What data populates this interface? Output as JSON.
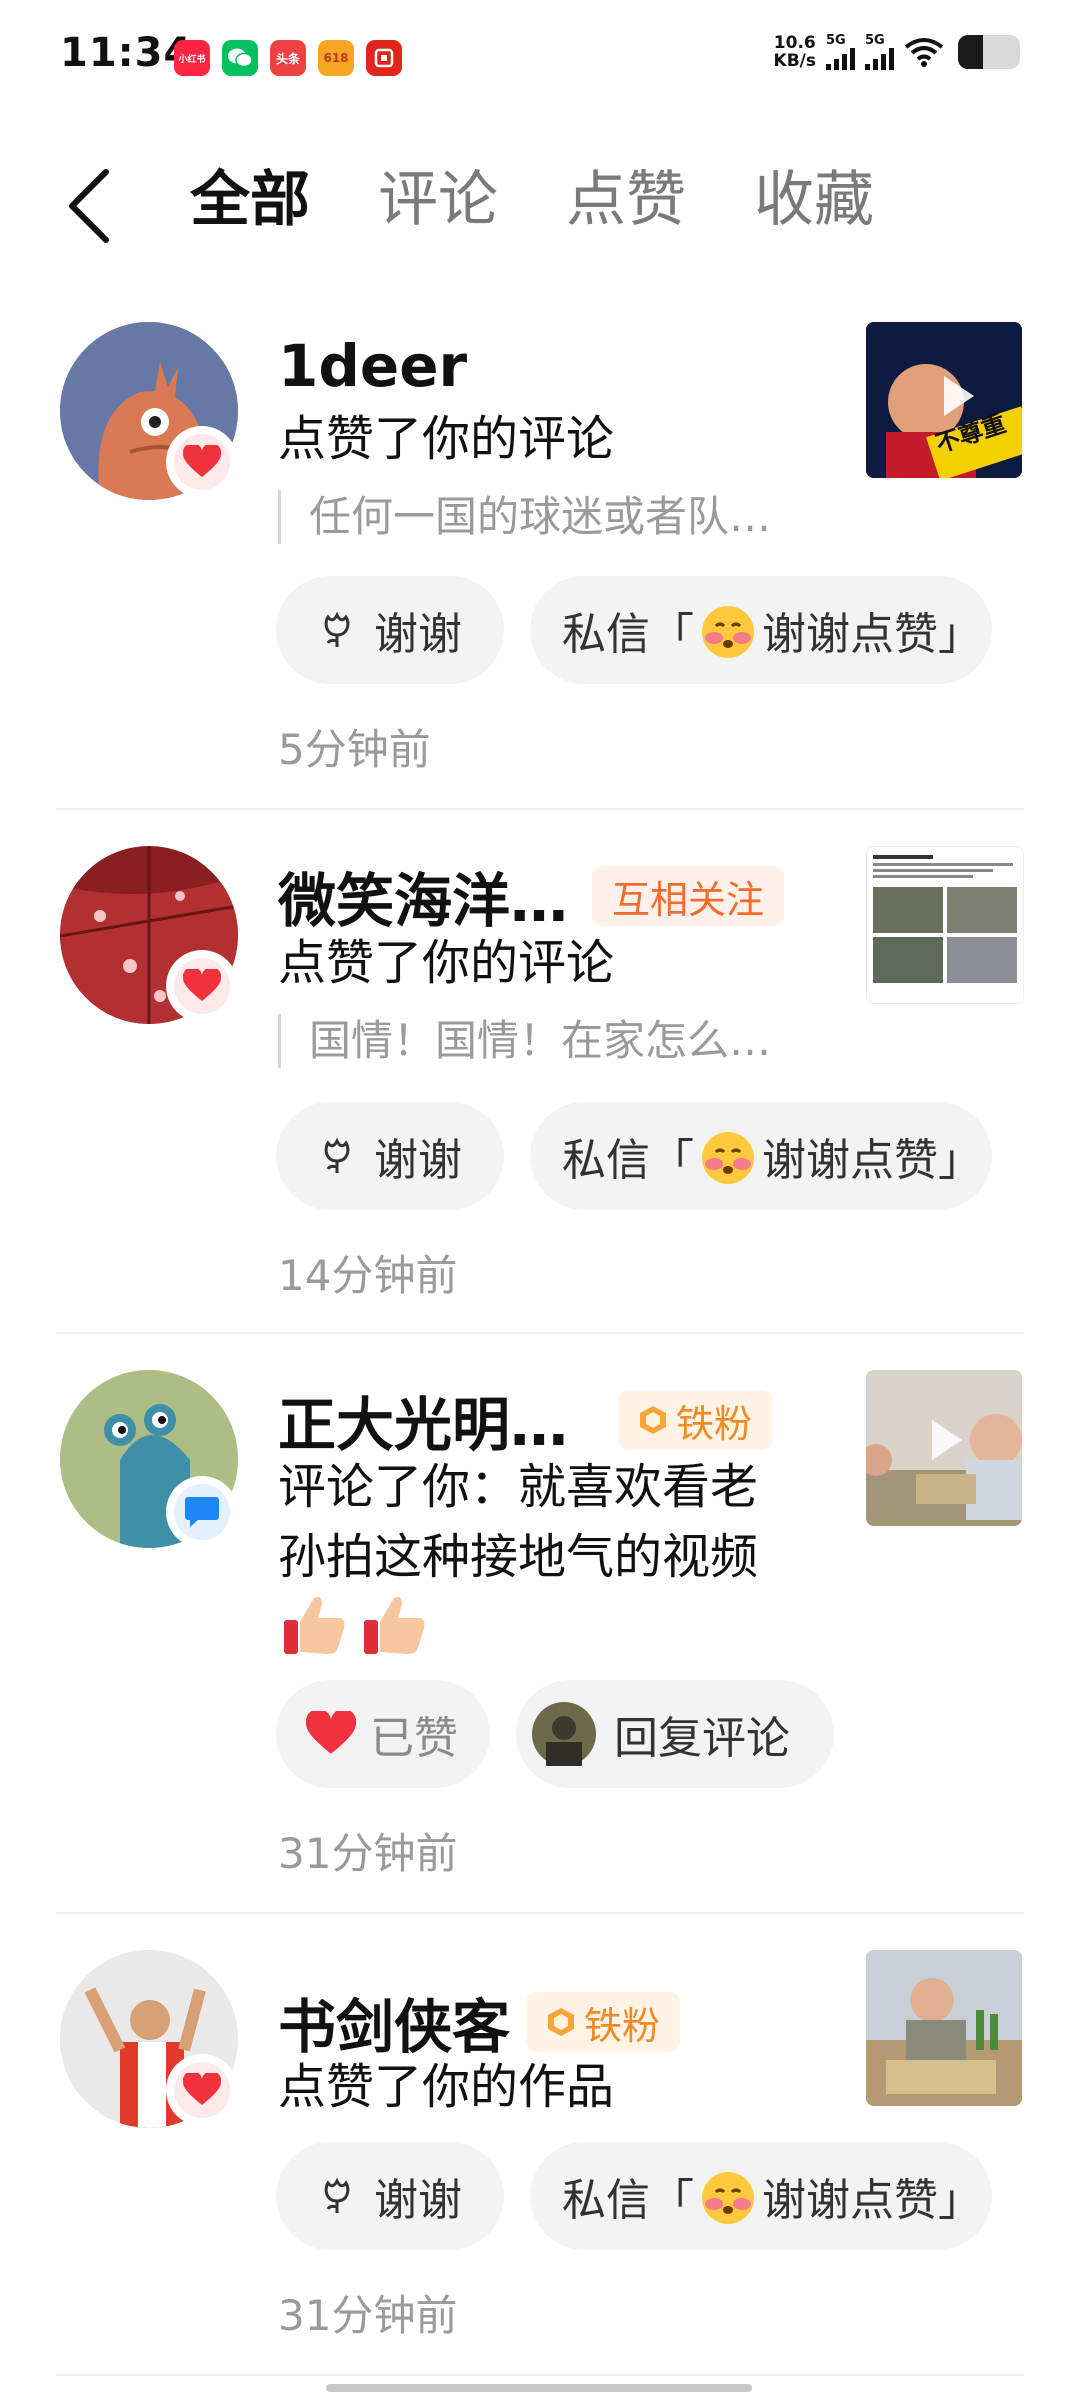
{
  "status": {
    "time": "11:34",
    "app_icons": [
      {
        "name": "xiaohongshu-icon",
        "label": "小红书",
        "color": "#ff2442"
      },
      {
        "name": "wechat-icon",
        "label": "",
        "color": "#07c160"
      },
      {
        "name": "toutiao-icon",
        "label": "头条",
        "color": "#f04142"
      },
      {
        "name": "shopping-618-icon",
        "label": "618",
        "color": "#f5a623"
      },
      {
        "name": "jd-icon",
        "label": "",
        "color": "#e1251b"
      }
    ],
    "net_speed_value": "10.6",
    "net_speed_unit": "KB/s",
    "sim1": "5G",
    "sim2": "5G",
    "battery_level": 0.4
  },
  "header": {
    "tabs": [
      {
        "label": "全部",
        "active": true
      },
      {
        "label": "评论",
        "active": false
      },
      {
        "label": "点赞",
        "active": false
      },
      {
        "label": "收藏",
        "active": false
      }
    ]
  },
  "notifications": [
    {
      "user": "1deer",
      "action": "点赞了你的评论",
      "quote": "任何一国的球迷或者队…",
      "thanks_label": "谢谢",
      "dm_prefix": "私信「",
      "dm_text": "谢谢点赞」",
      "time": "5分钟前",
      "thumb_caption": "不尊重",
      "badge": "heart"
    },
    {
      "user": "微笑海洋…",
      "tag": "互相关注",
      "action": "点赞了你的评论",
      "quote": "国情！国情！在家怎么…",
      "thanks_label": "谢谢",
      "dm_prefix": "私信「",
      "dm_text": "谢谢点赞」",
      "time": "14分钟前",
      "badge": "heart"
    },
    {
      "user": "正大光明…",
      "tag": "铁粉",
      "action_line1": "评论了你：就喜欢看老",
      "action_line2": "孙拍这种接地气的视频",
      "liked_label": "已赞",
      "reply_label": "回复评论",
      "time": "31分钟前",
      "badge": "comment"
    },
    {
      "user": "书剑侠客",
      "tag": "铁粉",
      "action": "点赞了你的作品",
      "thanks_label": "谢谢",
      "dm_prefix": "私信「",
      "dm_text": "谢谢点赞」",
      "time": "31分钟前",
      "badge": "heart"
    }
  ]
}
